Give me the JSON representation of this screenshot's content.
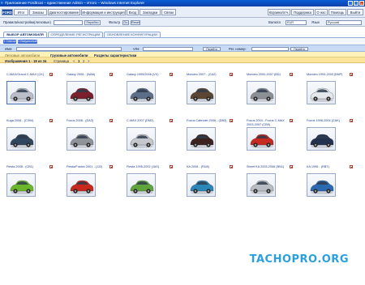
{
  "window": {
    "title": "Приложение FordEcat – единственная Admin – Итого – Windows Internet Explorer",
    "buttons": [
      "_",
      "□",
      "×"
    ]
  },
  "navbar": {
    "brand": "FORD",
    "items": [
      "Итог",
      "Заказы",
      "Диагностирование",
      "Информация и инструкция",
      "Вход",
      "Закладки",
      "Связи"
    ],
    "right_items": [
      "Корзина/отч.",
      "Поддержка",
      "О нас",
      "Помощь",
      "Выйти"
    ]
  },
  "search": {
    "vin_label": "Правила/настройки(легковые)",
    "go_label": "Перейти",
    "filter_label": "Фильтр",
    "filter_go": "Go",
    "reset_label": "Reset",
    "currency_label": "Валюта",
    "currency_value": "EUR",
    "language_label": "Язык",
    "language_value": "Русский"
  },
  "tabs": [
    "ВЫБОР АВТОМОБИЛЯ",
    "ОПРЕДЕЛЕНИЕ РЕГИСТРАЦИИ",
    "ОБНОВЛЕНИЕ КОНФИГУРАЦИИ"
  ],
  "filter_buttons": [
    "1 Список",
    "2 Визуальный"
  ],
  "filter_form": {
    "name_label": "Имя:",
    "vin_label": "VIN:",
    "go_label": "Перейти",
    "regnum_label": "Рег. номер:",
    "go2_label": "Перейти"
  },
  "type_tabs": [
    "Легковые автомобили",
    "Грузовые автомобили",
    "Разделы характеристики"
  ],
  "pager": {
    "images_label": "Изображения 1 - 18 из 34",
    "page_label": "Страница",
    "prev": "<",
    "current": "1",
    "next_page": "2",
    "next": ">"
  },
  "cars": [
    {
      "label": "C-MAX/Grand C-MAX (CK)",
      "color": "#b9bec8"
    },
    {
      "label": "Galaxy 2006 - (WA6)",
      "color": "#7a1f2b"
    },
    {
      "label": "Galaxy 1995/2006 (VX)",
      "color": "#5c6e88"
    },
    {
      "label": "Mondeo 2007 - (CA2)",
      "color": "#5a4632"
    },
    {
      "label": "Mondeo 2000-2007 (BD)",
      "color": "#8b9097"
    },
    {
      "label": "Mondeo 1993-2000 (BNP)",
      "color": "#e4e7eb"
    },
    {
      "label": "Kuga 2008 - (C394)",
      "color": "#31475f"
    },
    {
      "label": "Focus 2008 - (DA3)",
      "color": "#8e939a"
    },
    {
      "label": "C-MAX 2007 (DM2)",
      "color": "#c4c8cc"
    },
    {
      "label": "Focus Cabriolet 2006 - (DB3)",
      "color": "#3c2320"
    },
    {
      "label": "Focus 2004 - Focus C-MAX 2003-2007 (CB9)",
      "color": "#c72a22"
    },
    {
      "label": "Focus 1998-2004 (CAK)",
      "color": "#22324f"
    },
    {
      "label": "Fiesta 2008 - (CB1)",
      "color": "#6ab72a"
    },
    {
      "label": "Fiesta/Fusion 2001 - (JJ2)",
      "color": "#c8281e"
    },
    {
      "label": "Fiesta 1995-2002 (JAS)",
      "color": "#5fa43c"
    },
    {
      "label": "KA 2008 - (RU8)",
      "color": "#2a87b8"
    },
    {
      "label": "Street KA 2003-2006 (BN1)",
      "color": "#b8bdc4"
    },
    {
      "label": "KA 1996 - (RBT)",
      "color": "#2c69b0"
    }
  ],
  "watermark": "TACHOPRO.ORG"
}
